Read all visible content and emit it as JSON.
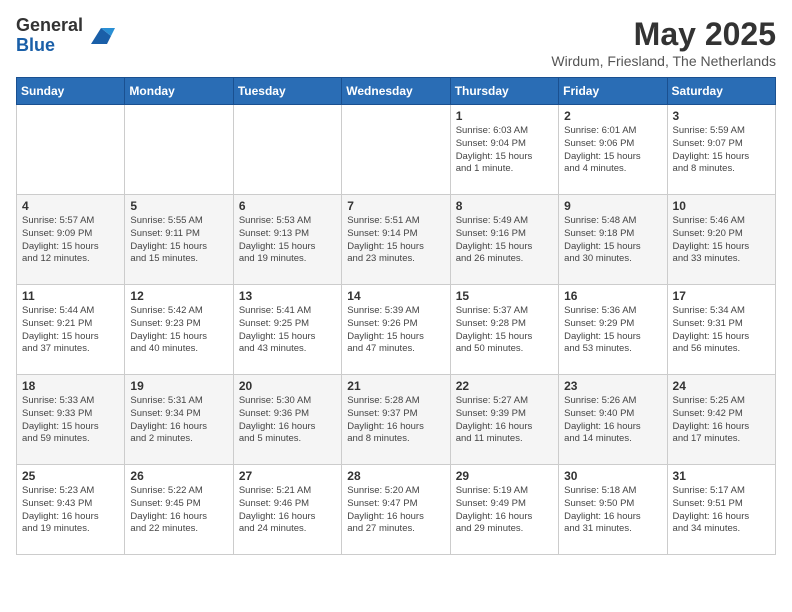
{
  "logo": {
    "general": "General",
    "blue": "Blue"
  },
  "title": "May 2025",
  "location": "Wirdum, Friesland, The Netherlands",
  "weekdays": [
    "Sunday",
    "Monday",
    "Tuesday",
    "Wednesday",
    "Thursday",
    "Friday",
    "Saturday"
  ],
  "weeks": [
    [
      {
        "day": "",
        "info": ""
      },
      {
        "day": "",
        "info": ""
      },
      {
        "day": "",
        "info": ""
      },
      {
        "day": "",
        "info": ""
      },
      {
        "day": "1",
        "info": "Sunrise: 6:03 AM\nSunset: 9:04 PM\nDaylight: 15 hours\nand 1 minute."
      },
      {
        "day": "2",
        "info": "Sunrise: 6:01 AM\nSunset: 9:06 PM\nDaylight: 15 hours\nand 4 minutes."
      },
      {
        "day": "3",
        "info": "Sunrise: 5:59 AM\nSunset: 9:07 PM\nDaylight: 15 hours\nand 8 minutes."
      }
    ],
    [
      {
        "day": "4",
        "info": "Sunrise: 5:57 AM\nSunset: 9:09 PM\nDaylight: 15 hours\nand 12 minutes."
      },
      {
        "day": "5",
        "info": "Sunrise: 5:55 AM\nSunset: 9:11 PM\nDaylight: 15 hours\nand 15 minutes."
      },
      {
        "day": "6",
        "info": "Sunrise: 5:53 AM\nSunset: 9:13 PM\nDaylight: 15 hours\nand 19 minutes."
      },
      {
        "day": "7",
        "info": "Sunrise: 5:51 AM\nSunset: 9:14 PM\nDaylight: 15 hours\nand 23 minutes."
      },
      {
        "day": "8",
        "info": "Sunrise: 5:49 AM\nSunset: 9:16 PM\nDaylight: 15 hours\nand 26 minutes."
      },
      {
        "day": "9",
        "info": "Sunrise: 5:48 AM\nSunset: 9:18 PM\nDaylight: 15 hours\nand 30 minutes."
      },
      {
        "day": "10",
        "info": "Sunrise: 5:46 AM\nSunset: 9:20 PM\nDaylight: 15 hours\nand 33 minutes."
      }
    ],
    [
      {
        "day": "11",
        "info": "Sunrise: 5:44 AM\nSunset: 9:21 PM\nDaylight: 15 hours\nand 37 minutes."
      },
      {
        "day": "12",
        "info": "Sunrise: 5:42 AM\nSunset: 9:23 PM\nDaylight: 15 hours\nand 40 minutes."
      },
      {
        "day": "13",
        "info": "Sunrise: 5:41 AM\nSunset: 9:25 PM\nDaylight: 15 hours\nand 43 minutes."
      },
      {
        "day": "14",
        "info": "Sunrise: 5:39 AM\nSunset: 9:26 PM\nDaylight: 15 hours\nand 47 minutes."
      },
      {
        "day": "15",
        "info": "Sunrise: 5:37 AM\nSunset: 9:28 PM\nDaylight: 15 hours\nand 50 minutes."
      },
      {
        "day": "16",
        "info": "Sunrise: 5:36 AM\nSunset: 9:29 PM\nDaylight: 15 hours\nand 53 minutes."
      },
      {
        "day": "17",
        "info": "Sunrise: 5:34 AM\nSunset: 9:31 PM\nDaylight: 15 hours\nand 56 minutes."
      }
    ],
    [
      {
        "day": "18",
        "info": "Sunrise: 5:33 AM\nSunset: 9:33 PM\nDaylight: 15 hours\nand 59 minutes."
      },
      {
        "day": "19",
        "info": "Sunrise: 5:31 AM\nSunset: 9:34 PM\nDaylight: 16 hours\nand 2 minutes."
      },
      {
        "day": "20",
        "info": "Sunrise: 5:30 AM\nSunset: 9:36 PM\nDaylight: 16 hours\nand 5 minutes."
      },
      {
        "day": "21",
        "info": "Sunrise: 5:28 AM\nSunset: 9:37 PM\nDaylight: 16 hours\nand 8 minutes."
      },
      {
        "day": "22",
        "info": "Sunrise: 5:27 AM\nSunset: 9:39 PM\nDaylight: 16 hours\nand 11 minutes."
      },
      {
        "day": "23",
        "info": "Sunrise: 5:26 AM\nSunset: 9:40 PM\nDaylight: 16 hours\nand 14 minutes."
      },
      {
        "day": "24",
        "info": "Sunrise: 5:25 AM\nSunset: 9:42 PM\nDaylight: 16 hours\nand 17 minutes."
      }
    ],
    [
      {
        "day": "25",
        "info": "Sunrise: 5:23 AM\nSunset: 9:43 PM\nDaylight: 16 hours\nand 19 minutes."
      },
      {
        "day": "26",
        "info": "Sunrise: 5:22 AM\nSunset: 9:45 PM\nDaylight: 16 hours\nand 22 minutes."
      },
      {
        "day": "27",
        "info": "Sunrise: 5:21 AM\nSunset: 9:46 PM\nDaylight: 16 hours\nand 24 minutes."
      },
      {
        "day": "28",
        "info": "Sunrise: 5:20 AM\nSunset: 9:47 PM\nDaylight: 16 hours\nand 27 minutes."
      },
      {
        "day": "29",
        "info": "Sunrise: 5:19 AM\nSunset: 9:49 PM\nDaylight: 16 hours\nand 29 minutes."
      },
      {
        "day": "30",
        "info": "Sunrise: 5:18 AM\nSunset: 9:50 PM\nDaylight: 16 hours\nand 31 minutes."
      },
      {
        "day": "31",
        "info": "Sunrise: 5:17 AM\nSunset: 9:51 PM\nDaylight: 16 hours\nand 34 minutes."
      }
    ]
  ]
}
